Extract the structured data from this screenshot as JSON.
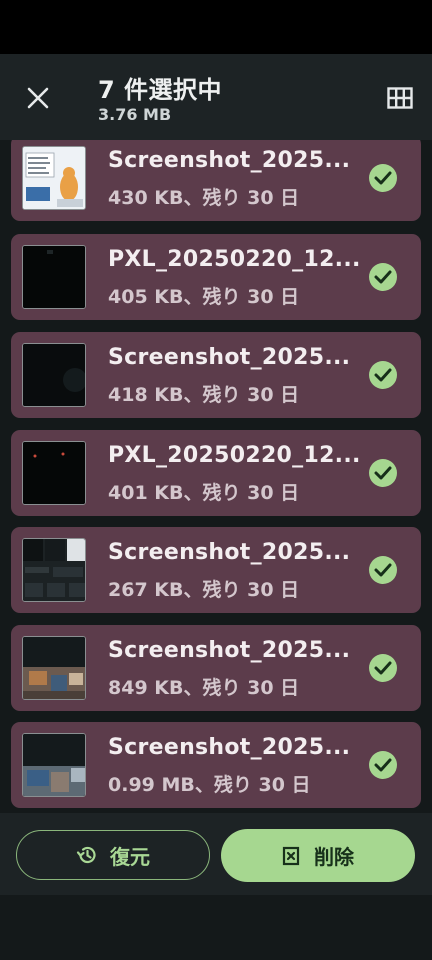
{
  "header": {
    "title": "7 件選択中",
    "subtitle": "3.76 MB",
    "close_icon": "close-icon",
    "view_icon": "grid-view-icon"
  },
  "items": [
    {
      "name": "Screenshot_2025...",
      "meta": "430 KB、残り 30 日",
      "selected": true
    },
    {
      "name": "PXL_20250220_12...",
      "meta": "405 KB、残り 30 日",
      "selected": true
    },
    {
      "name": "Screenshot_2025...",
      "meta": "418 KB、残り 30 日",
      "selected": true
    },
    {
      "name": "PXL_20250220_12...",
      "meta": "401 KB、残り 30 日",
      "selected": true
    },
    {
      "name": "Screenshot_2025...",
      "meta": "267 KB、残り 30 日",
      "selected": true
    },
    {
      "name": "Screenshot_2025...",
      "meta": "849 KB、残り 30 日",
      "selected": true
    },
    {
      "name": "Screenshot_2025...",
      "meta": "0.99 MB、残り 30 日",
      "selected": true
    }
  ],
  "actions": {
    "restore_label": "復元",
    "delete_label": "削除"
  },
  "colors": {
    "item_bg": "#5c3c4b",
    "accent_green": "#a6d790",
    "surface": "#1d2325"
  }
}
